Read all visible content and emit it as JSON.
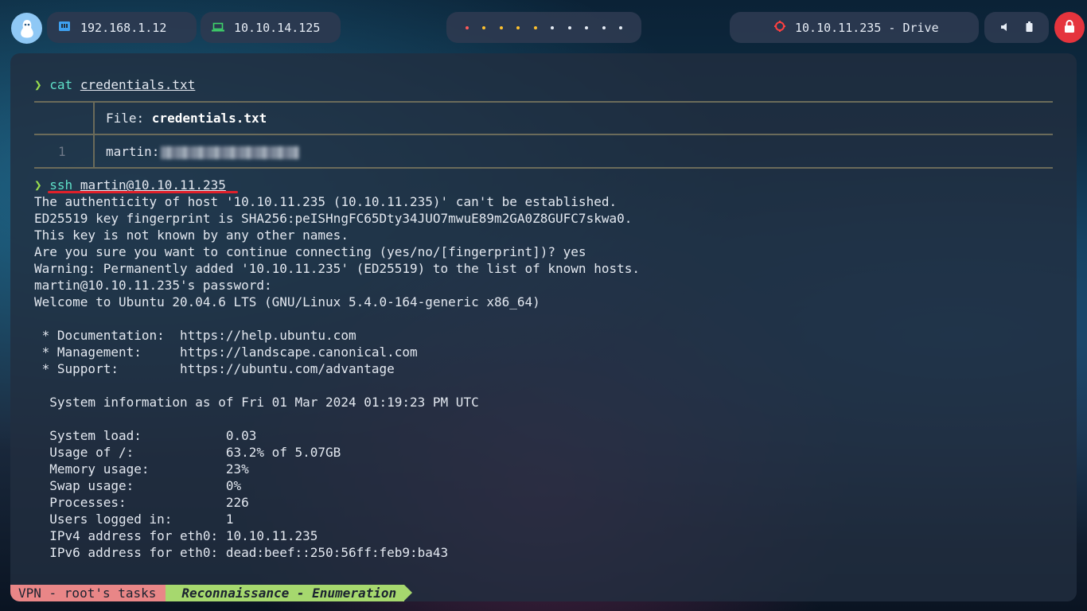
{
  "topbar": {
    "logo_icon": "linux-penguin-icon",
    "local_ip": "192.168.1.12",
    "local_icon": "ethernet-icon",
    "vpn_ip": "10.10.14.125",
    "vpn_icon": "laptop-icon",
    "workspaces": [
      {
        "state": "active",
        "color": "#ff5a5a"
      },
      {
        "state": "occupied",
        "color": "#ffc22e"
      },
      {
        "state": "occupied",
        "color": "#ffc22e"
      },
      {
        "state": "occupied",
        "color": "#ffc22e"
      },
      {
        "state": "occupied",
        "color": "#ffc22e"
      },
      {
        "state": "empty",
        "color": "#e6ecf5"
      },
      {
        "state": "empty",
        "color": "#e6ecf5"
      },
      {
        "state": "empty",
        "color": "#e6ecf5"
      },
      {
        "state": "empty",
        "color": "#e6ecf5"
      },
      {
        "state": "empty",
        "color": "#e6ecf5"
      }
    ],
    "target": "10.10.11.235 - Drive",
    "target_icon": "target-icon",
    "volume_icon": "speaker-icon",
    "battery_icon": "battery-icon",
    "lock_icon": "lock-icon"
  },
  "terminal": {
    "prompt_symbol": "❯",
    "cmd1": {
      "command": "cat",
      "argument": "credentials.txt"
    },
    "bat": {
      "file_label": "File: ",
      "file_name": "credentials.txt",
      "line_number": "1",
      "content_visible": "martin:"
    },
    "cmd2": {
      "command": "ssh",
      "argument": "martin@10.10.11.235"
    },
    "output": [
      "The authenticity of host '10.10.11.235 (10.10.11.235)' can't be established.",
      "ED25519 key fingerprint is SHA256:peISHngFC65Dty34JUO7mwuE89m2GA0Z8GUFC7skwa0.",
      "This key is not known by any other names.",
      "Are you sure you want to continue connecting (yes/no/[fingerprint])? yes",
      "Warning: Permanently added '10.10.11.235' (ED25519) to the list of known hosts.",
      "martin@10.10.11.235's password:",
      "Welcome to Ubuntu 20.04.6 LTS (GNU/Linux 5.4.0-164-generic x86_64)",
      "",
      " * Documentation:  https://help.ubuntu.com",
      " * Management:     https://landscape.canonical.com",
      " * Support:        https://ubuntu.com/advantage",
      "",
      "  System information as of Fri 01 Mar 2024 01:19:23 PM UTC",
      "",
      "  System load:           0.03",
      "  Usage of /:            63.2% of 5.07GB",
      "  Memory usage:          23%",
      "  Swap usage:            0%",
      "  Processes:             226",
      "  Users logged in:       1",
      "  IPv4 address for eth0: 10.10.11.235",
      "  IPv6 address for eth0: dead:beef::250:56ff:feb9:ba43"
    ]
  },
  "statusline": {
    "session": "VPN - root's tasks",
    "window": "Reconnaissance - Enumeration"
  }
}
